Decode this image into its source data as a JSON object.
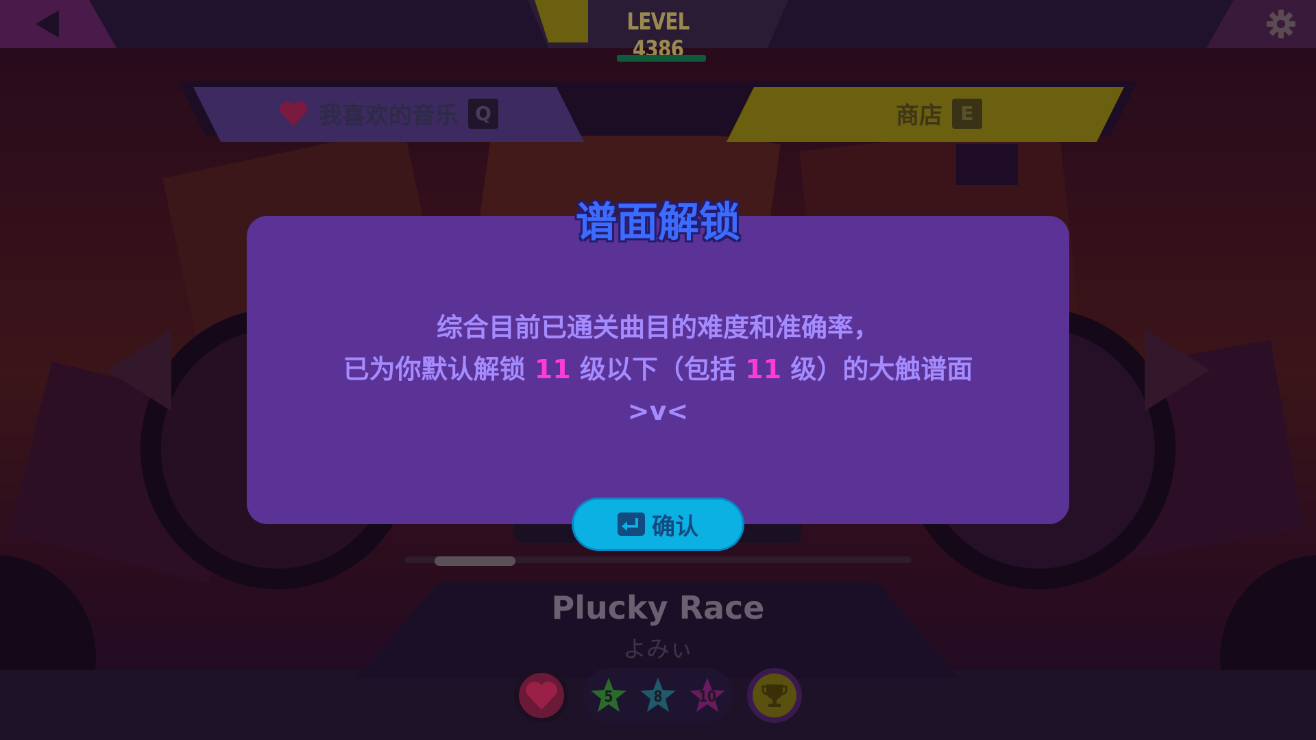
{
  "header": {
    "level_text": "LEVEL 4386",
    "back_icon": "back-arrow-icon",
    "settings_icon": "gear-icon"
  },
  "tabs": {
    "favorites": {
      "label": "我喜欢的音乐",
      "key": "Q",
      "icon": "heart-icon"
    },
    "shop": {
      "label": "商店",
      "key": "E"
    }
  },
  "song": {
    "title": "Plucky Race",
    "artist": "よみぃ",
    "difficulties": [
      "5",
      "8",
      "10"
    ]
  },
  "modal": {
    "title": "谱面解锁",
    "line1": "综合目前已通关曲目的难度和准确率，",
    "line2_prefix": "已为你默认解锁 ",
    "level_a": "11",
    "line2_mid": " 级以下（包括 ",
    "level_b": "11",
    "line2_suffix": " 级）的大触谱面",
    "line3": ">v<",
    "confirm_label": "确认",
    "confirm_icon": "enter-key-icon"
  },
  "colors": {
    "modal_bg": "#5b3296",
    "title_blue": "#3c6cff",
    "body_text": "#a48cff",
    "highlight_pink": "#ff3ad9",
    "confirm_bg": "#0bb1e2"
  }
}
